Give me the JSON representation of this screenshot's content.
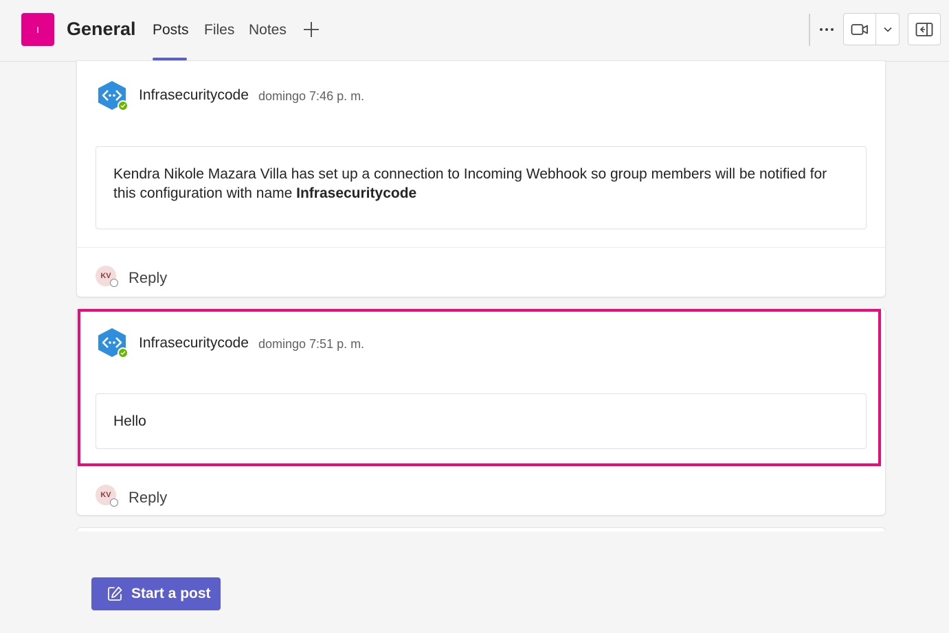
{
  "header": {
    "team_initial": "I",
    "channel_title": "General",
    "tabs": [
      {
        "label": "Posts",
        "active": true
      },
      {
        "label": "Files",
        "active": false
      },
      {
        "label": "Notes",
        "active": false
      }
    ],
    "accent_color": "#5b5fc7",
    "team_color": "#e3008c"
  },
  "posts": [
    {
      "sender": "Infrasecuritycode",
      "timestamp": "domingo 7:46 p. m.",
      "message_prefix": "Kendra Nikole Mazara Villa has set up a connection to Incoming Webhook so group members will be notified for this configuration with name ",
      "message_bold": "Infrasecuritycode",
      "reply_initials": "KV",
      "reply_label": "Reply"
    },
    {
      "sender": "Infrasecuritycode",
      "timestamp": "domingo 7:51 p. m.",
      "message": "Hello",
      "reply_initials": "KV",
      "reply_label": "Reply",
      "highlighted": true
    }
  ],
  "composer": {
    "start_post_label": "Start a post"
  },
  "highlight_color": "#ea0c7c"
}
